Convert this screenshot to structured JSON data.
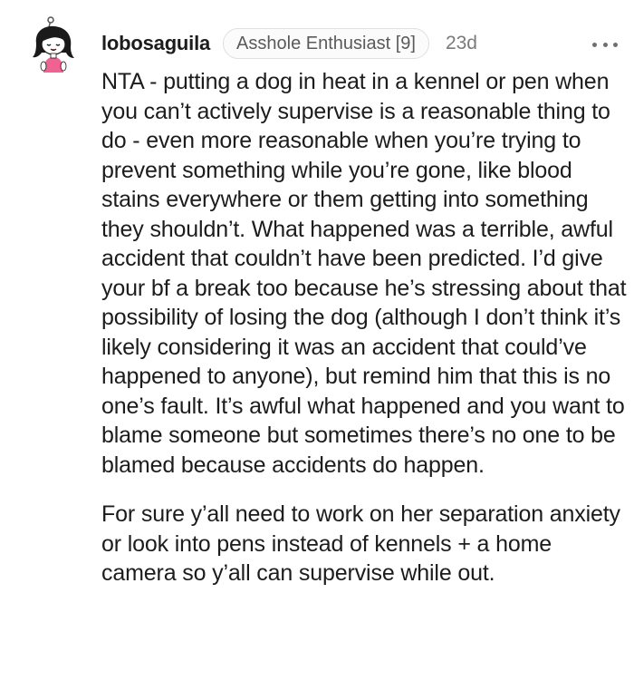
{
  "comment": {
    "username": "lobosaguila",
    "flair": "Asshole Enthusiast [9]",
    "age": "23d",
    "paragraphs": [
      "NTA - putting a dog in heat in a kennel or pen when you can’t actively supervise is a reasonable thing to do - even more reasonable when you’re trying to prevent something while you’re gone, like blood stains everywhere or them getting into something they shouldn’t. What happened was a terrible, awful accident that couldn’t have been predicted. I’d give your bf a break too because he’s stressing about that possibility of losing the dog (although I don’t think it’s likely considering it was an accident that could’ve happened to anyone), but remind him that this is no one’s fault. It’s awful what happened and you want to blame someone but sometimes there’s no one to be blamed because accidents do happen.",
      "For sure y’all need to work on her separation anxiety or look into pens instead of kennels + a home camera so y’all can supervise while out."
    ]
  },
  "icons": {
    "avatar": "user-avatar-cartoon-girl",
    "more": "more-options-icon"
  },
  "colors": {
    "text": "#1c1c1c",
    "meta": "#7a7a7a",
    "flair_border": "#e0e0e0",
    "avatar_shirt": "#f06292"
  }
}
